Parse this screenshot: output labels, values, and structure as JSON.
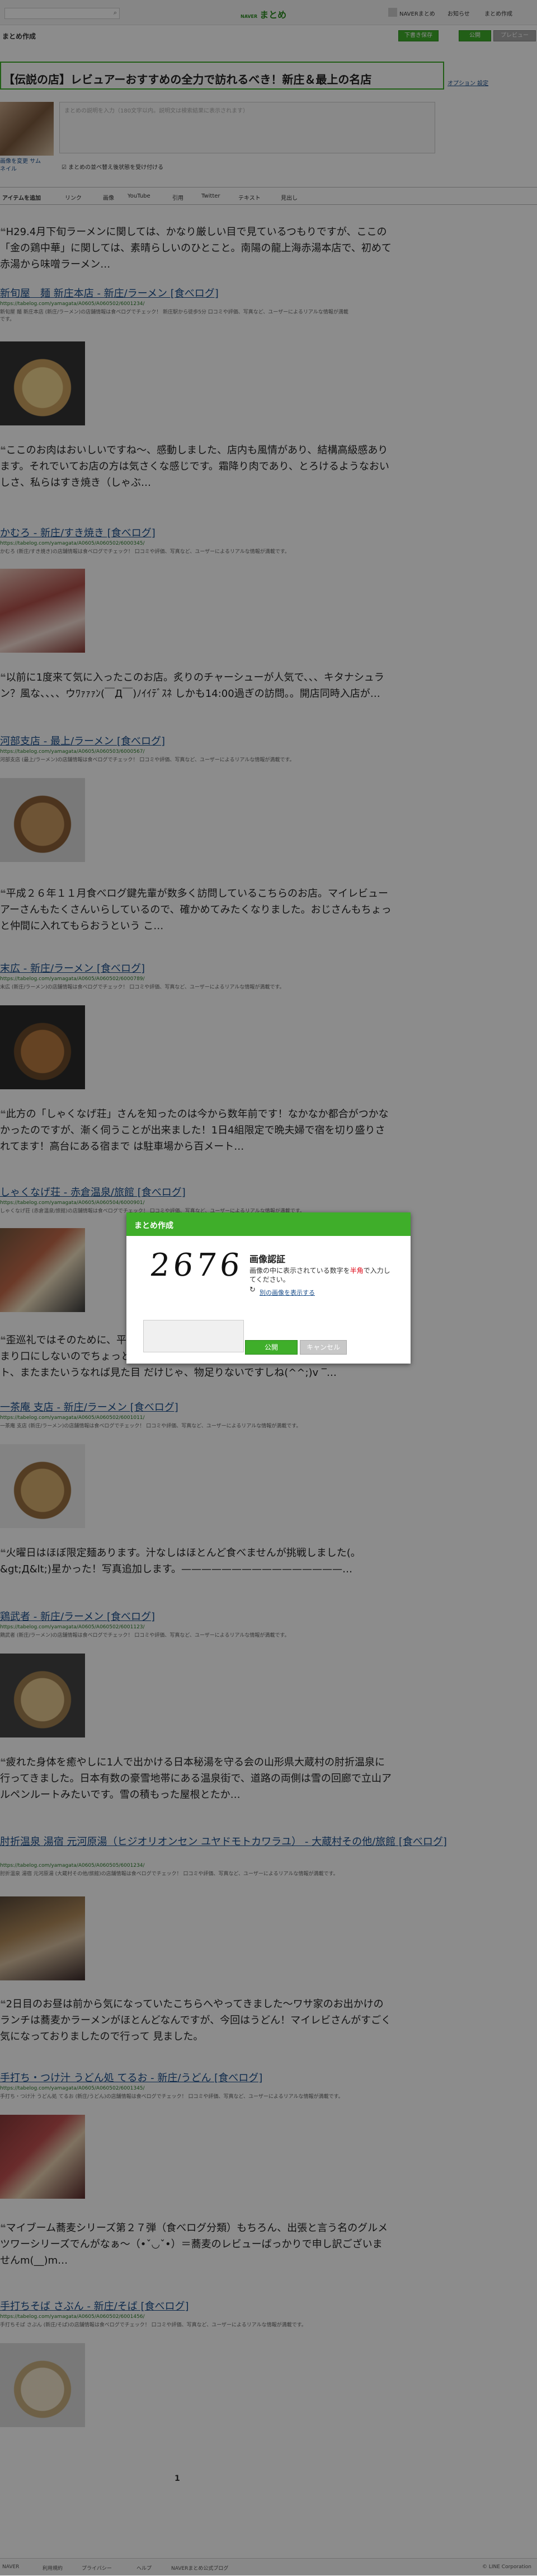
{
  "header": {
    "search_placeholder": "",
    "logo_small": "NAVER",
    "logo": "まとめ",
    "nav": [
      "NAVERまとめ",
      "お知らせ",
      "まとめ作成"
    ]
  },
  "toolbar_top": {
    "title": "まとめ作成",
    "draft_btn": "下書き保存",
    "publish_btn": "公開",
    "preview_btn": "プレビュー"
  },
  "editor": {
    "title": "【伝説の店】レビュアーおすすめの全力で訪れるべき！新庄＆最上の名店",
    "options": "オプション 設定",
    "thumb_label": "画像を変更 サムネイル",
    "description_placeholder": "まとめの説明を入力（180文字以内。説明文は検索結果に表示されます）",
    "checkbox_label": "まとめの並べ替え後状態を受け付ける"
  },
  "tabs": [
    "アイテムを追加",
    "リンク",
    "画像",
    "YouTube",
    "引用",
    "Twitter",
    "テキスト",
    "見出し"
  ],
  "items": [
    {
      "quote": "H29.4月下旬ラーメンに関しては、かなり厳しい目で見ているつもりですが、ここの「金の鶏中華」に関しては、素晴らしいのひとこと。南陽の龍上海赤湯本店で、初めて赤湯から味噌ラーメン…",
      "shop": "新旬屋　麺 新庄本店 - 新庄/ラーメン [食べログ]",
      "url": "https://tabelog.com/yamagata/A0605/A060502/6001234/",
      "desc": "新旬屋 麺 新庄本店 (新庄/ラーメン)の店舗情報は食べログでチェック！ 新庄駅から徒歩5分 口コミや評価、写真など、ユーザーによるリアルな情報が満載です。"
    },
    {
      "quote": "ここのお肉はおいしいですね～、感動しました、店内も風情があり、結構高級感あります。それでいてお店の方は気さくな感じです。霜降り肉であり、とろけるようなおいしさ、私らはすき焼き（しゃぶ…",
      "shop": "かむろ - 新庄/すき焼き [食べログ]",
      "url": "https://tabelog.com/yamagata/A0605/A060502/6000345/",
      "desc": "かむろ (新庄/すき焼き)の店舗情報は食べログでチェック！ 口コミや評価、写真など、ユーザーによるリアルな情報が満載です。"
    },
    {
      "quote": "以前に1度来て気に入ったこのお店。炙りのチャーシューが人気で、、、キタナシュラン？風な、、、、ウﾜｧｧｧﾝ(￣Д￣)ﾉｲｲﾃﾞｽﾈ しかも14:00過ぎの訪問。。開店同時入店が…",
      "shop": "河部支店 - 最上/ラーメン [食べログ]",
      "url": "https://tabelog.com/yamagata/A0605/A060503/6000567/",
      "desc": "河部支店 (最上/ラーメン)の店舗情報は食べログでチェック！ 口コミや評価、写真など、ユーザーによるリアルな情報が満載です。"
    },
    {
      "quote": "平成２６年１１月食べログ鍵先輩が数多く訪問しているこちらのお店。マイレビューアーさんもたくさんいらしているので、確かめてみたくなりました。おじさんもちょっと仲間に入れてもらおうという こ…",
      "shop": "末広 - 新庄/ラーメン [食べログ]",
      "url": "https://tabelog.com/yamagata/A0605/A060502/6000789/",
      "desc": "末広 (新庄/ラーメン)の店舗情報は食べログでチェック！ 口コミや評価、写真など、ユーザーによるリアルな情報が満載です。"
    },
    {
      "quote": "此方の「しゃくなげ荘」さんを知ったのは今から数年前です！なかなか都合がつかなかったのですが、漸く伺うことが出来ました！1日4組限定で晩夫婦で宿を切り盛りされてます！高台にある宿まで は駐車場から百メート…",
      "shop": "しゃくなげ荘 - 赤倉温泉/旅館 [食べログ]",
      "url": "https://tabelog.com/yamagata/A0605/A060504/6000901/",
      "desc": "しゃくなげ荘 (赤倉温泉/旅館)の店舗情報は食べログでチェック！ 口コミや評価、写真など、ユーザーによるリアルな情報が満載です。"
    },
    {
      "quote": "歪巡礼ではそのために、平成２８年４月に尾花沢...と違いますか。2016年…最近あまり口にしないのでちょっと朝に帰ろうと運転している。ここもまたとてもいいコメント、またまたいうなれば見た目 だけじゃ、物足りないですしね(^^;)v ‾…",
      "shop": "",
      "url": "",
      "desc": ""
    },
    {
      "quote": "",
      "shop": "一茶庵 支店 - 新庄/ラーメン [食べログ]",
      "url": "https://tabelog.com/yamagata/A0605/A060502/6001011/",
      "desc": "一茶庵 支店 (新庄/ラーメン)の店舗情報は食べログでチェック！ 口コミや評価、写真など、ユーザーによるリアルな情報が満載です。"
    },
    {
      "quote": "火曜日はほぼ限定麺あります。汁なしはほとんど食べませんが挑戦しました(。&gt;Д&lt;)星かった！写真追加します。————————————————…",
      "shop": "鶏武者 - 新庄/ラーメン [食べログ]",
      "url": "https://tabelog.com/yamagata/A0605/A060502/6001123/",
      "desc": "鶏武者 (新庄/ラーメン)の店舗情報は食べログでチェック！ 口コミや評価、写真など、ユーザーによるリアルな情報が満載です。"
    },
    {
      "quote": "疲れた身体を癒やしに1人で出かける日本秘湯を守る会の山形県大蔵村の肘折温泉に行ってきました。日本有数の豪雪地帯にある温泉街で、道路の両側は雪の回廊で立山アルペンルートみたいです。雪の積もった屋根とたか…",
      "shop": "肘折温泉 湯宿 元河原湯（ヒジオリオンセン ユヤドモトカワラユ） - 大蔵村その他/旅館 [食べログ]",
      "url": "https://tabelog.com/yamagata/A0605/A060505/6001234/",
      "desc": "肘折温泉 湯宿 元河原湯 (大蔵村その他/旅館)の店舗情報は食べログでチェック！ 口コミや評価、写真など、ユーザーによるリアルな情報が満載です。"
    },
    {
      "quote": "2日目のお昼は前から気になっていたこちらへやってきました〜ワサ家のお出かけのランチは蕎麦かラーメンがほとんどなんですが、今回はうどん！マイレビさんがすごく気になっておりましたので行って 見ました。",
      "shop": "手打ち・つけ汁 うどん処 てるお - 新庄/うどん [食べログ]",
      "url": "https://tabelog.com/yamagata/A0605/A060502/6001345/",
      "desc": "手打ち・つけ汁 うどん処 てるお (新庄/うどん)の店舗情報は食べログでチェック！ 口コミや評価、写真など、ユーザーによるリアルな情報が満載です。"
    },
    {
      "quote": "マイブーム蕎麦シリーズ第２７弾（食べログ分類）もちろん、出張と言う名のグルメツワーシリーズでんがなぁ〜（•ˇ◡ˇ•）＝蕎麦のレビューばっかりで申し訳ございませんm(__)m…",
      "shop": "手打ちそば さぶん - 新庄/そば [食べログ]",
      "url": "https://tabelog.com/yamagata/A0605/A060502/6001456/",
      "desc": "手打ちそば さぶん (新庄/そば)の店舗情報は食べログでチェック！ 口コミや評価、写真など、ユーザーによるリアルな情報が満載です。"
    }
  ],
  "pager": "1",
  "footer": [
    "NAVER",
    "利用規約",
    "プライバシー",
    "ヘルプ",
    "NAVERまとめ公式ブログ",
    "© LINE Corporation"
  ],
  "modal": {
    "header": "まとめ作成",
    "captcha_text": "2676",
    "title": "画像認証",
    "desc_pre": "画像の中に表示されている数字を",
    "desc_red": "半角",
    "desc_post": "で入力してください。",
    "reload": "別の画像を表示する",
    "ok": "公開",
    "cancel": "キャンセル"
  },
  "colors": {
    "brand": "#3fae2a",
    "link": "#1a4e8a",
    "alert": "#dd0011"
  }
}
